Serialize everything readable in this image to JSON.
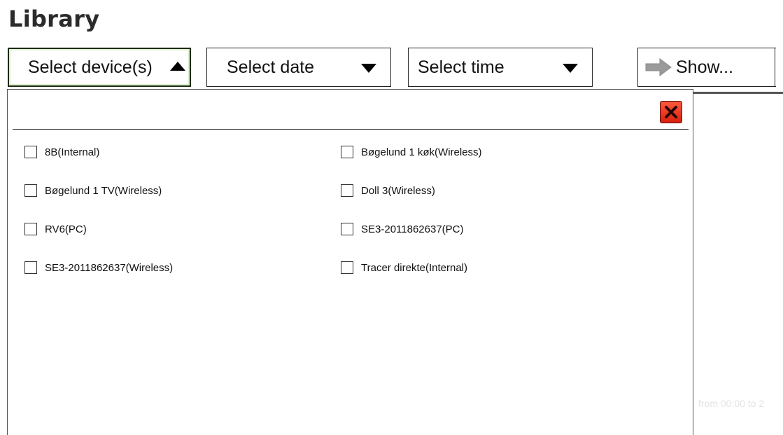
{
  "page": {
    "title": "Library"
  },
  "toolbar": {
    "devices_label": "Select device(s)",
    "date_label": "Select date",
    "time_label": "Select time",
    "show_label": "Show..."
  },
  "background": {
    "faint_text": "from 00:00 to 2"
  },
  "devices": {
    "items": [
      {
        "label": "8B(Internal)",
        "checked": false
      },
      {
        "label": "Bøgelund 1 køk(Wireless)",
        "checked": false
      },
      {
        "label": "Bøgelund 1 TV(Wireless)",
        "checked": false
      },
      {
        "label": "Doll 3(Wireless)",
        "checked": false
      },
      {
        "label": "RV6(PC)",
        "checked": false
      },
      {
        "label": "SE3-2011862637(PC)",
        "checked": false
      },
      {
        "label": "SE3-2011862637(Wireless)",
        "checked": false
      },
      {
        "label": "Tracer direkte(Internal)",
        "checked": false
      }
    ]
  },
  "colors": {
    "close_button": "#e02a14",
    "arrow_icon": "#9a9a9a",
    "title": "#2b2b2b"
  },
  "icons": {
    "devices_open": "triangle-up-icon",
    "dropdown": "triangle-down-icon",
    "show": "arrow-right-icon",
    "close": "close-x-icon"
  }
}
